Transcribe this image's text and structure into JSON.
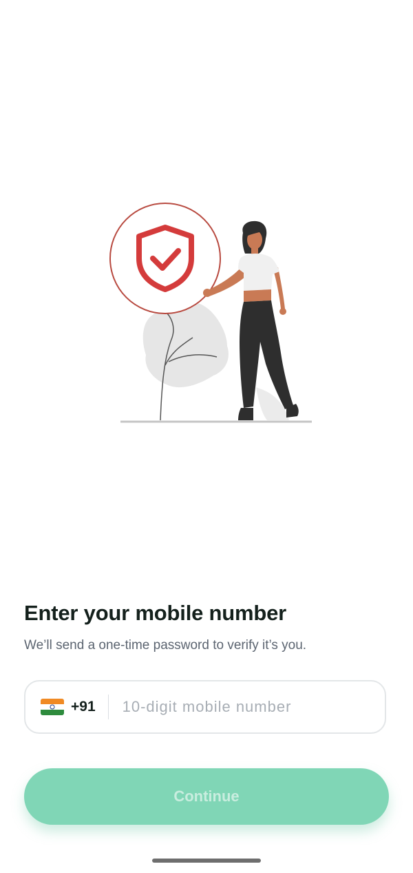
{
  "header": {
    "title": "Enter your mobile number",
    "subtitle": "We’ll send a one-time password to verify it’s you."
  },
  "phone": {
    "country_code": "+91",
    "flag_icon": "india-flag-icon",
    "placeholder": "10-digit mobile number",
    "value": ""
  },
  "actions": {
    "continue_label": "Continue"
  },
  "colors": {
    "accent": "#80d6b6",
    "shield": "#d43b3b",
    "heading": "#14201c"
  }
}
